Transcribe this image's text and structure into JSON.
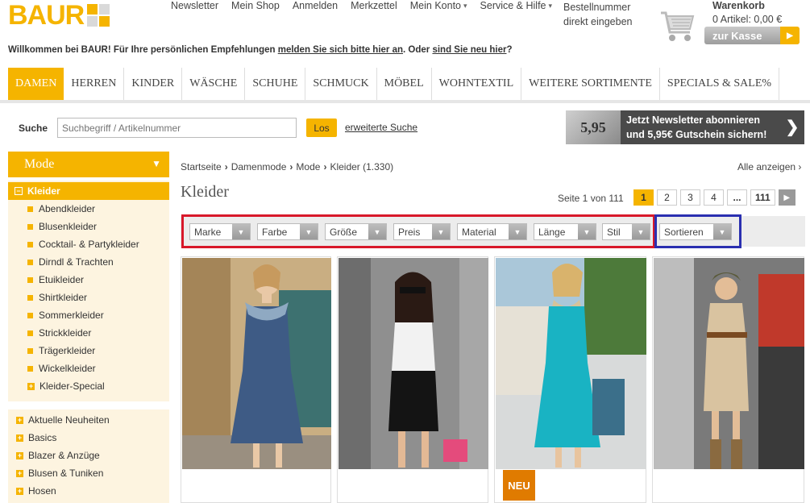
{
  "brand": {
    "logo_text": "BAUR",
    "color": "#f5b400"
  },
  "topnav": {
    "items": [
      {
        "label": "Newsletter",
        "dropdown": false
      },
      {
        "label": "Mein Shop",
        "dropdown": false
      },
      {
        "label": "Anmelden",
        "dropdown": false
      },
      {
        "label": "Merkzettel",
        "dropdown": false
      },
      {
        "label": "Mein Konto",
        "dropdown": true
      },
      {
        "label": "Service & Hilfe",
        "dropdown": true
      }
    ],
    "order_line1": "Bestellnummer",
    "order_line2": "direkt eingeben"
  },
  "cart": {
    "title": "Warenkorb",
    "count": "0 Artikel: 0,00 €",
    "checkout": "zur Kasse"
  },
  "welcome": {
    "prefix": "Willkommen bei BAUR! Für Ihre persönlichen Empfehlungen",
    "login_link": "melden Sie sich bitte hier an",
    "middle": ". Oder",
    "register_link": "sind Sie neu hier",
    "suffix": "?"
  },
  "categories": [
    {
      "label": "DAMEN",
      "active": true
    },
    {
      "label": "HERREN",
      "active": false
    },
    {
      "label": "KINDER",
      "active": false
    },
    {
      "label": "WÄSCHE",
      "active": false
    },
    {
      "label": "SCHUHE",
      "active": false
    },
    {
      "label": "SCHMUCK",
      "active": false
    },
    {
      "label": "MÖBEL",
      "active": false
    },
    {
      "label": "WOHNTEXTIL",
      "active": false
    },
    {
      "label": "WEITERE SORTIMENTE",
      "active": false
    },
    {
      "label": "SPECIALS & SALE%",
      "active": false
    }
  ],
  "search": {
    "label": "Suche",
    "placeholder": "Suchbegriff / Artikelnummer",
    "button": "Los",
    "advanced": "erweiterte Suche"
  },
  "newsletter_banner": {
    "price": "5,95",
    "line1": "Jetzt Newsletter abonnieren",
    "line2": "und 5,95€ Gutschein sichern!"
  },
  "sidebar": {
    "heading": "Mode",
    "active": "Kleider",
    "subitems": [
      "Abendkleider",
      "Blusenkleider",
      "Cocktail- & Partykleider",
      "Dirndl & Trachten",
      "Etuikleider",
      "Shirtkleider",
      "Sommerkleider",
      "Strickkleider",
      "Trägerkleider",
      "Wickelkleider"
    ],
    "special": "Kleider-Special",
    "groups": [
      "Aktuelle Neuheiten",
      "Basics",
      "Blazer & Anzüge",
      "Blusen & Tuniken",
      "Hosen"
    ]
  },
  "breadcrumb": {
    "items": [
      "Startseite",
      "Damenmode",
      "Mode",
      "Kleider (1.330)"
    ],
    "show_all": "Alle anzeigen"
  },
  "page": {
    "title": "Kleider",
    "info": "Seite 1 von 111"
  },
  "pager": {
    "pages": [
      "1",
      "2",
      "3",
      "4",
      "...",
      "111"
    ],
    "current": "1"
  },
  "filters": [
    "Marke",
    "Farbe",
    "Größe",
    "Preis",
    "Material",
    "Länge",
    "Stil"
  ],
  "sort": {
    "label": "Sortieren"
  },
  "products": [
    {
      "dress_color": "#3e5b85",
      "bg": "#b89a70",
      "badge": ""
    },
    {
      "dress_color": "#1a1a1a",
      "bg": "#8c8c8c",
      "badge": ""
    },
    {
      "dress_color": "#19b3c3",
      "bg": "#cfd6d6",
      "badge": "NEU"
    },
    {
      "dress_color": "#d9c3a0",
      "bg": "#6e6e6e",
      "badge": ""
    }
  ],
  "colors": {
    "accent": "#f5b400",
    "filter_highlight": "#d8182a",
    "sort_highlight": "#2a2fb0",
    "sidebar_bg": "#fdf4e0"
  }
}
